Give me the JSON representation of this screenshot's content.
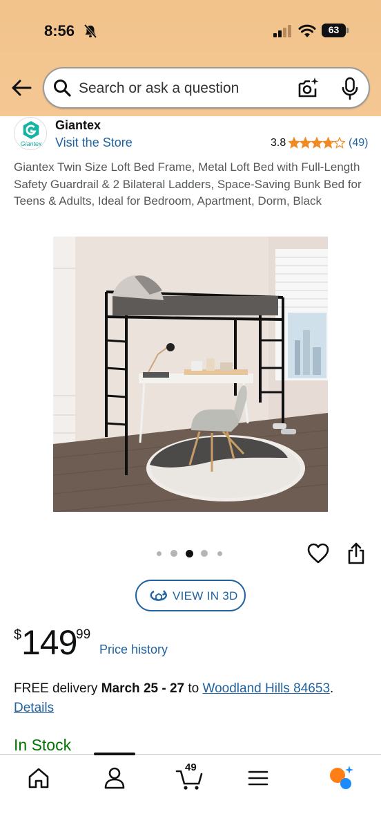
{
  "status_bar": {
    "time": "8:56",
    "battery": "63"
  },
  "search": {
    "placeholder": "Search or ask a question"
  },
  "brand": {
    "logo_text": "Giantex",
    "name": "Giantex",
    "visit_label": "Visit the Store",
    "rating": "3.8",
    "stars": 3.8,
    "review_count": "(49)"
  },
  "product": {
    "title": "Giantex Twin Size Loft Bed Frame, Metal Loft Bed with Full-Length Safety Guardrail & 2 Bilateral Ladders, Space-Saving Bunk Bed for Teens & Adults, Ideal for Bedroom, Apartment, Dorm, Black",
    "image_count": 5,
    "active_image": 3
  },
  "actions": {
    "view3d_label": "VIEW IN 3D"
  },
  "price": {
    "currency": "$",
    "whole": "149",
    "fraction": "99",
    "history_label": "Price history"
  },
  "delivery": {
    "prefix": "FREE delivery ",
    "dates": "March 25 - 27",
    "mid": " to ",
    "location": "Woodland Hills 84653",
    "suffix": ".",
    "details_label": "Details"
  },
  "availability": {
    "label": "In Stock"
  },
  "tabbar": {
    "cart_count": "49",
    "items": [
      "home-icon",
      "account-icon",
      "cart-icon",
      "menu-icon",
      "rufus-icon"
    ]
  },
  "colors": {
    "header_bg": "#f4c793",
    "link": "#2162a1",
    "in_stock": "#007600",
    "star": "#f08a24",
    "text": "#0f1111"
  }
}
